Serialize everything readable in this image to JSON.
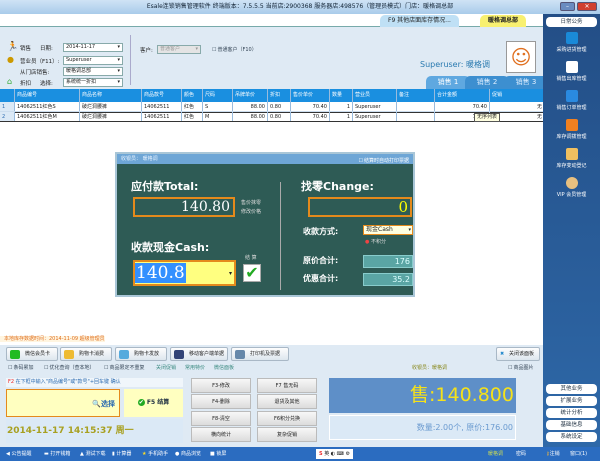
{
  "window": {
    "title": "Esale连锁销售管理软件 终端版本：7.5.5.5 当前店:2900368 服务器店:498576（管理员模式）门店：暖格调总部",
    "minimize": "–",
    "close": "✕"
  },
  "top_tabs": [
    {
      "label": "F9 其他店面库存情况..."
    },
    {
      "label": "暖格调总部"
    }
  ],
  "form": {
    "sale_label": "销售",
    "date_label": "日期:",
    "date": "2014-11-17",
    "clerk_label": "营业员（F11）:",
    "clerk": "Superuser",
    "from_store_label": "从门店销售:",
    "from_store": "暖格调总部",
    "discount_label": "折扣",
    "select_label": "选择:",
    "discount": "系统统一折扣",
    "customer_label": "客户:",
    "customer_placeholder": "普通客户",
    "normal_customer": "普通客户（F10）",
    "user_display": "Superuser: 暖格调"
  },
  "sales_tabs": [
    "销售 1",
    "销售 2",
    "销售 3"
  ],
  "table": {
    "headers": [
      "",
      "商品编号",
      "商品名称",
      "商品款号",
      "颜色",
      "尺码",
      "吊牌单价",
      "折扣",
      "售价单价",
      "数量",
      "营业员",
      "备注",
      "合计金额",
      "促销"
    ],
    "rows": [
      [
        "1",
        "14062511红色S",
        "破烂洞腰裤",
        "14062511",
        "红色",
        "S",
        "88.00",
        "0.80",
        "70.40",
        "1",
        "Superuser",
        "",
        "70.40",
        "无"
      ],
      [
        "2",
        "14062511红色M",
        "破烂洞腰裤",
        "14062511",
        "红色",
        "M",
        "88.00",
        "0.80",
        "70.40",
        "1",
        "Superuser",
        "",
        "70.40",
        "无"
      ]
    ],
    "tooltip": "无序列表"
  },
  "modal": {
    "cashier": "收银员： 暖格调",
    "auto_print": "结算时自动打印票据",
    "total_label": "应付款Total:",
    "total": "140.80",
    "round_link": "售价抹零",
    "edit_price_link": "修改价格",
    "cash_label": "收款现金Cash:",
    "cash": "140.8",
    "settle_label": "结 算",
    "change_label": "找零Change:",
    "change": "0",
    "pay_method_label": "收款方式:",
    "pay_method": "现金Cash",
    "no_points": "不积分",
    "orig_total_label": "原价合计:",
    "orig_total": "176",
    "discount_total_label": "优惠合计:",
    "discount_total": "35.2"
  },
  "status_line": "本地库存数据时间：2014-11-09  超级管理员",
  "buttons": [
    "微信会员卡",
    "购物卡消费",
    "购物卡发放",
    "移动客户端单据",
    "打印机及票据"
  ],
  "close_panel": "关闭该面板",
  "checkboxes": [
    "条码累加",
    "优化查询（查本地）",
    "商品限定不重复"
  ],
  "links": [
    "关闭促销",
    "常用特价",
    "微信面板"
  ],
  "cashier_label": "收银员：暖格调",
  "product_image": "商品图片",
  "hint": "在下框中输入\"商品编号\"或\"款号\"+回车键 确认",
  "hint_key": "F2",
  "select_btn": "选择",
  "settle_btn": "F5 结算",
  "datetime": "2014-11-17  14:15:37  周一",
  "fkeys": [
    "F3-修改",
    "F7 售无码",
    "F4-删除",
    "退货及其他",
    "F8-清空",
    "F6积分兑换",
    "横向统计",
    "复杂促销"
  ],
  "sale_total": "售:140.800",
  "summary": "数量:2.00个, 原价:176.00",
  "sidebar": {
    "top": "日常公务",
    "items": [
      "采购进货管理",
      "销售出库管理",
      "销售订单管理",
      "库存调拨管理",
      "库存变动登记",
      "VIP 会员管理"
    ],
    "bottom": [
      "其他业务",
      "扩展业务",
      "统计分析",
      "基础信息",
      "系统设定"
    ],
    "logout": "注销",
    "window": "窗口(1)"
  },
  "taskbar": [
    "公告提醒",
    "打开钱箱",
    "测试下载",
    "计算器",
    "手机助手",
    "商品浏览",
    "锁屏"
  ],
  "taskbar_right": [
    "暖格调",
    "密码"
  ],
  "ime": "英",
  "colors": {
    "accent": "#1a8fe0",
    "sidebar": "#2a5d9a",
    "modal": "#2e5b55",
    "total_text": "#f5e11a"
  }
}
